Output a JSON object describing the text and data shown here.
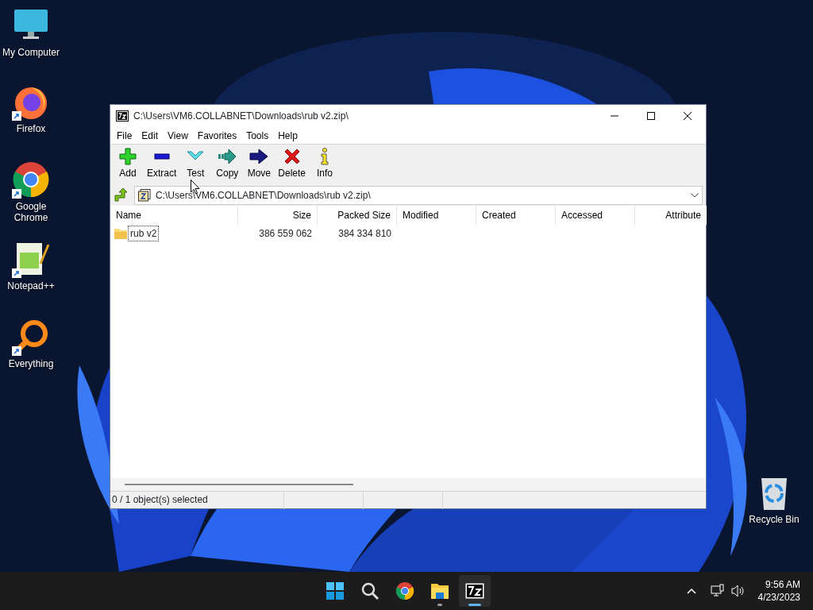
{
  "desktop_icons": [
    {
      "label": "My Computer",
      "kind": "computer",
      "shortcut": false
    },
    {
      "label": "Firefox",
      "kind": "firefox",
      "shortcut": true
    },
    {
      "label": "Google Chrome",
      "kind": "chrome",
      "shortcut": true
    },
    {
      "label": "Notepad++",
      "kind": "notepad",
      "shortcut": true
    },
    {
      "label": "Everything",
      "kind": "everything",
      "shortcut": true
    },
    {
      "label": "Recycle Bin",
      "kind": "recycle",
      "shortcut": false
    }
  ],
  "window": {
    "title": "C:\\Users\\VM6.COLLABNET\\Downloads\\rub v2.zip\\",
    "menu": [
      "File",
      "Edit",
      "View",
      "Favorites",
      "Tools",
      "Help"
    ],
    "toolbar": [
      {
        "label": "Add",
        "kind": "add"
      },
      {
        "label": "Extract",
        "kind": "extract"
      },
      {
        "label": "Test",
        "kind": "test"
      },
      {
        "label": "Copy",
        "kind": "copy"
      },
      {
        "label": "Move",
        "kind": "move"
      },
      {
        "label": "Delete",
        "kind": "delete"
      },
      {
        "label": "Info",
        "kind": "info"
      }
    ],
    "address": "C:\\Users\\VM6.COLLABNET\\Downloads\\rub v2.zip\\",
    "columns": [
      "Name",
      "Size",
      "Packed Size",
      "Modified",
      "Created",
      "Accessed",
      "Attribute"
    ],
    "rows": [
      {
        "name": "rub v2",
        "kind": "folder",
        "focused": true,
        "size": "386 559 062",
        "packed_size": "384 334 810"
      }
    ],
    "status_bar": "0 / 1 object(s) selected"
  },
  "taskbar": {
    "apps": [
      {
        "kind": "start",
        "running": false,
        "active": false
      },
      {
        "kind": "search",
        "running": false,
        "active": false
      },
      {
        "kind": "chrome",
        "running": false,
        "active": false
      },
      {
        "kind": "explorer",
        "running": true,
        "active": false
      },
      {
        "kind": "sevenzip",
        "running": true,
        "active": true
      }
    ],
    "time": "9:56 AM",
    "date": "4/23/2023"
  }
}
